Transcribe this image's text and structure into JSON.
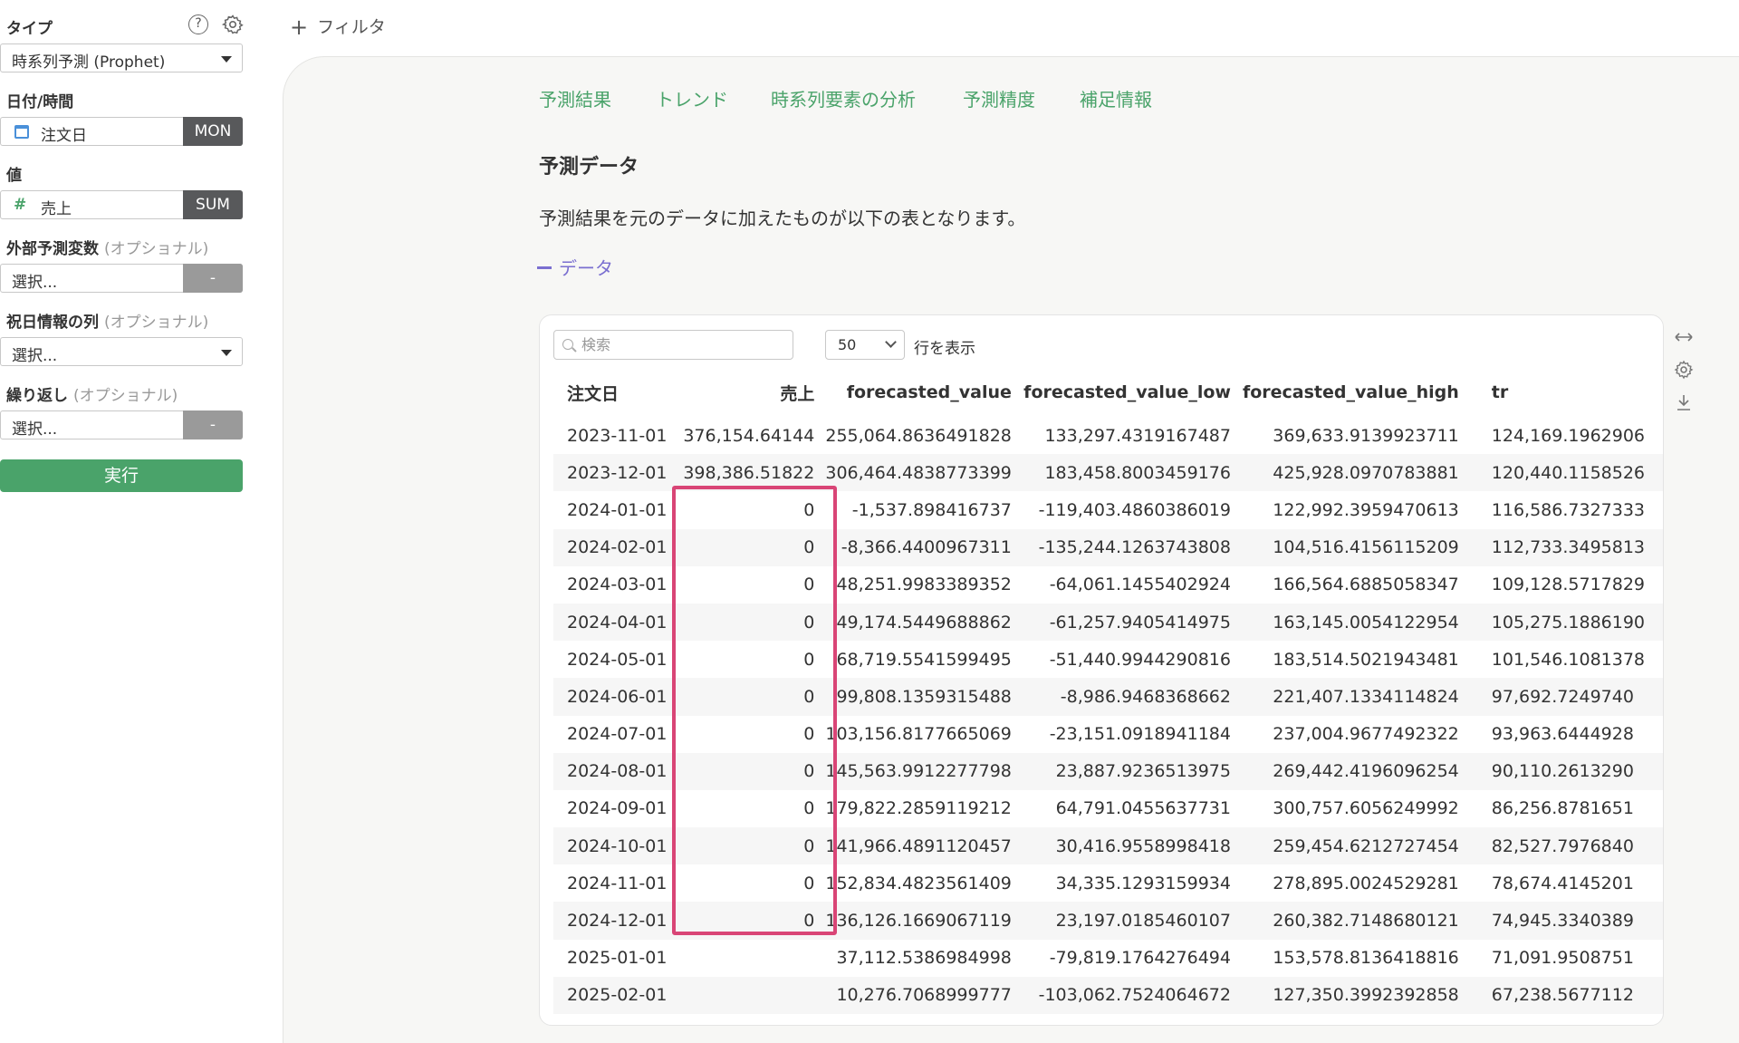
{
  "sidebar": {
    "type_label": "タイプ",
    "type_value": "時系列予測 (Prophet)",
    "date_label": "日付/時間",
    "date_field": "注文日",
    "date_tag": "MON",
    "value_label": "値",
    "value_field_icon": "#",
    "value_field": "売上",
    "value_tag": "SUM",
    "ext_label": "外部予測変数",
    "ext_optional": "(オプショナル)",
    "ext_placeholder": "選択...",
    "ext_tag": "-",
    "holiday_label": "祝日情報の列",
    "holiday_optional": "(オプショナル)",
    "holiday_placeholder": "選択...",
    "repeat_label": "繰り返し",
    "repeat_optional": "(オプショナル)",
    "repeat_placeholder": "選択...",
    "repeat_tag": "-",
    "help_glyph": "?",
    "run_label": "実行"
  },
  "top": {
    "filter_plus": "+",
    "filter_label": "フィルタ"
  },
  "tabs": [
    "予測結果",
    "トレンド",
    "時系列要素の分析",
    "予測精度",
    "補足情報"
  ],
  "main": {
    "section_title": "予測データ",
    "description": "予測結果を元のデータに加えたものが以下の表となります。",
    "toggle_label": "データ"
  },
  "table_controls": {
    "search_placeholder": "検索",
    "rows_value": "50",
    "rows_label": "行を表示"
  },
  "table": {
    "headers": [
      "注文日",
      "売上",
      "forecasted_value",
      "forecasted_value_low",
      "forecasted_value_high",
      "tr"
    ],
    "rows": [
      [
        "2023-11-01",
        "376,154.64144",
        "255,064.8636491828",
        "133,297.4319167487",
        "369,633.9139923711",
        "124,169.1962906"
      ],
      [
        "2023-12-01",
        "398,386.51822",
        "306,464.4838773399",
        "183,458.8003459176",
        "425,928.0970783881",
        "120,440.1158526"
      ],
      [
        "2024-01-01",
        "0",
        "-1,537.898416737",
        "-119,403.4860386019",
        "122,992.3959470613",
        "116,586.7327333"
      ],
      [
        "2024-02-01",
        "0",
        "-8,366.4400967311",
        "-135,244.1263743808",
        "104,516.4156115209",
        "112,733.3495813"
      ],
      [
        "2024-03-01",
        "0",
        "48,251.9983389352",
        "-64,061.1455402924",
        "166,564.6885058347",
        "109,128.5717829"
      ],
      [
        "2024-04-01",
        "0",
        "49,174.5449688862",
        "-61,257.9405414975",
        "163,145.0054122954",
        "105,275.1886190"
      ],
      [
        "2024-05-01",
        "0",
        "68,719.5541599495",
        "-51,440.9944290816",
        "183,514.5021943481",
        "101,546.1081378"
      ],
      [
        "2024-06-01",
        "0",
        "99,808.1359315488",
        "-8,986.9468368662",
        "221,407.1334114824",
        "97,692.7249740"
      ],
      [
        "2024-07-01",
        "0",
        "103,156.8177665069",
        "-23,151.0918941184",
        "237,004.9677492322",
        "93,963.6444928"
      ],
      [
        "2024-08-01",
        "0",
        "145,563.9912277798",
        "23,887.9236513975",
        "269,442.4196096254",
        "90,110.2613290"
      ],
      [
        "2024-09-01",
        "0",
        "179,822.2859119212",
        "64,791.0455637731",
        "300,757.6056249992",
        "86,256.8781651"
      ],
      [
        "2024-10-01",
        "0",
        "141,966.4891120457",
        "30,416.9558998418",
        "259,454.6212727454",
        "82,527.7976840"
      ],
      [
        "2024-11-01",
        "0",
        "152,834.4823561409",
        "34,335.1293159934",
        "278,895.0024529281",
        "78,674.4145201"
      ],
      [
        "2024-12-01",
        "0",
        "136,126.1669067119",
        "23,197.0185460107",
        "260,382.7148680121",
        "74,945.3340389"
      ],
      [
        "2025-01-01",
        "",
        "37,112.5386984998",
        "-79,819.1764276494",
        "153,578.8136418816",
        "71,091.9508751"
      ],
      [
        "2025-02-01",
        "",
        "10,276.7068999777",
        "-103,062.7524064672",
        "127,350.3992392858",
        "67,238.5677112"
      ]
    ]
  },
  "colors": {
    "accent": "#4aa36a",
    "highlight": "#d94576",
    "toggle": "#7a6fd0"
  },
  "icons": [
    "help-icon",
    "gear-icon",
    "calendar-icon",
    "hash-icon",
    "search-icon",
    "chevron-down-icon",
    "expand-icon",
    "settings-icon",
    "download-icon",
    "plus-icon",
    "minus-icon"
  ]
}
